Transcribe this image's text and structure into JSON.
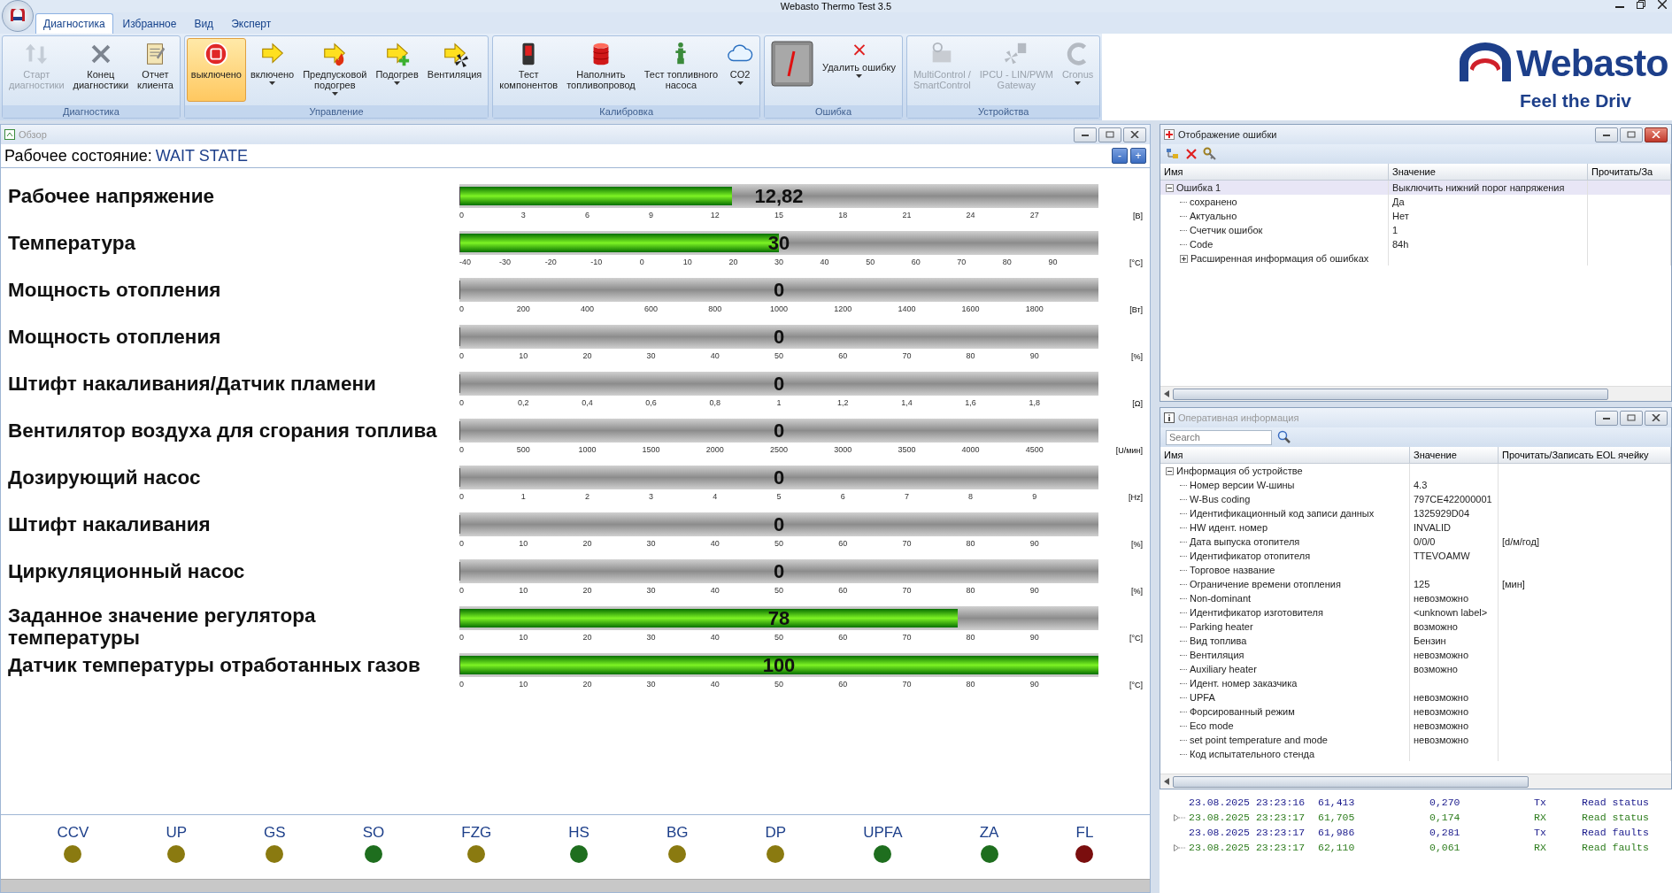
{
  "window": {
    "title": "Webasto Thermo Test 3.5"
  },
  "tabs": [
    {
      "label": "Диагностика",
      "selected": true
    },
    {
      "label": "Избранное",
      "selected": false
    },
    {
      "label": "Вид",
      "selected": false
    },
    {
      "label": "Эксперт",
      "selected": false
    }
  ],
  "ribbon": [
    {
      "group": "Диагностика",
      "buttons": [
        {
          "label": "Старт\nдиагностики",
          "disabled": true,
          "selected": false,
          "dropdown": false
        },
        {
          "label": "Конец\nдиагностики",
          "disabled": false,
          "selected": false,
          "dropdown": false
        },
        {
          "label": "Отчет\nклиента",
          "disabled": false,
          "selected": false,
          "dropdown": false
        }
      ]
    },
    {
      "group": "Управление",
      "buttons": [
        {
          "label": "выключено",
          "disabled": false,
          "selected": true,
          "dropdown": false
        },
        {
          "label": "включено",
          "disabled": false,
          "selected": false,
          "dropdown": true
        },
        {
          "label": "Предпусковой\nподогрев",
          "disabled": false,
          "selected": false,
          "dropdown": true
        },
        {
          "label": "Подогрев",
          "disabled": false,
          "selected": false,
          "dropdown": true
        },
        {
          "label": "Вентиляция",
          "disabled": false,
          "selected": false,
          "dropdown": false
        }
      ]
    },
    {
      "group": "Калибровка",
      "buttons": [
        {
          "label": "Тест\nкомпонентов",
          "disabled": false,
          "selected": false,
          "dropdown": false
        },
        {
          "label": "Наполнить\nтопливопровод",
          "disabled": false,
          "selected": false,
          "dropdown": false
        },
        {
          "label": "Тест топливного\nнасоса",
          "disabled": false,
          "selected": false,
          "dropdown": false
        },
        {
          "label": "CO2",
          "disabled": false,
          "selected": false,
          "dropdown": true
        }
      ]
    },
    {
      "group": "Ошибка",
      "buttons": [
        {
          "disabled": false,
          "selected": false,
          "dropdown": false
        },
        {
          "label": "Удалить ошибку",
          "disabled": false,
          "selected": false,
          "dropdown": true
        }
      ]
    },
    {
      "group": "Устройства",
      "buttons": [
        {
          "label": "MultiControl /\nSmartControl",
          "disabled": true,
          "selected": false,
          "dropdown": false
        },
        {
          "label": "IPCU - LIN/PWM\nGateway",
          "disabled": true,
          "selected": false,
          "dropdown": false
        },
        {
          "label": "Cronus",
          "disabled": true,
          "selected": false,
          "dropdown": true
        }
      ]
    }
  ],
  "logo": {
    "name": "Webasto",
    "tagline": "Feel the Driv"
  },
  "overview": {
    "title": "Обзор",
    "active": false,
    "state_label": "Рабочее состояние:",
    "state_value": "WAIT STATE",
    "buttons": [
      "-",
      "+"
    ],
    "gauges": [
      {
        "label": "Рабочее напряжение",
        "value": "12,82",
        "level": 0.427,
        "unit": "[B]",
        "ticks": [
          "0",
          "3",
          "6",
          "9",
          "12",
          "15",
          "18",
          "21",
          "24",
          "27"
        ]
      },
      {
        "label": "Температура",
        "value": "30",
        "level": 0.5,
        "unit": "[°C]",
        "ticks": [
          "-40",
          "-30",
          "-20",
          "-10",
          "0",
          "10",
          "20",
          "30",
          "40",
          "50",
          "60",
          "70",
          "80",
          "90"
        ]
      },
      {
        "label": "Мощность отопления",
        "value": "0",
        "level": 0,
        "unit": "[Вт]",
        "ticks": [
          "0",
          "200",
          "400",
          "600",
          "800",
          "1000",
          "1200",
          "1400",
          "1600",
          "1800"
        ]
      },
      {
        "label": "Мощность отопления",
        "value": "0",
        "level": 0,
        "unit": "[%]",
        "ticks": [
          "0",
          "10",
          "20",
          "30",
          "40",
          "50",
          "60",
          "70",
          "80",
          "90"
        ]
      },
      {
        "label": "Штифт накаливания/Датчик пламени",
        "value": "0",
        "level": 0,
        "unit": "[Ω]",
        "ticks": [
          "0",
          "0,2",
          "0,4",
          "0,6",
          "0,8",
          "1",
          "1,2",
          "1,4",
          "1,6",
          "1,8"
        ]
      },
      {
        "label": "Вентилятор воздуха для сгорания топлива",
        "value": "0",
        "level": 0,
        "unit": "[U/мин]",
        "ticks": [
          "0",
          "500",
          "1000",
          "1500",
          "2000",
          "2500",
          "3000",
          "3500",
          "4000",
          "4500"
        ]
      },
      {
        "label": "Дозирующий насос",
        "value": "0",
        "level": 0,
        "unit": "[Hz]",
        "ticks": [
          "0",
          "1",
          "2",
          "3",
          "4",
          "5",
          "6",
          "7",
          "8",
          "9"
        ]
      },
      {
        "label": "Штифт накаливания",
        "value": "0",
        "level": 0,
        "unit": "[%]",
        "ticks": [
          "0",
          "10",
          "20",
          "30",
          "40",
          "50",
          "60",
          "70",
          "80",
          "90"
        ]
      },
      {
        "label": "Циркуляционный насос",
        "value": "0",
        "level": 0,
        "unit": "[%]",
        "ticks": [
          "0",
          "10",
          "20",
          "30",
          "40",
          "50",
          "60",
          "70",
          "80",
          "90"
        ]
      },
      {
        "label": "Заданное значение регулятора температуры",
        "value": "78",
        "level": 0.78,
        "unit": "[°C]",
        "ticks": [
          "0",
          "10",
          "20",
          "30",
          "40",
          "50",
          "60",
          "70",
          "80",
          "90"
        ]
      },
      {
        "label": "Датчик температуры отработанных газов",
        "value": "100",
        "level": 1,
        "unit": "[°C]",
        "ticks": [
          "0",
          "10",
          "20",
          "30",
          "40",
          "50",
          "60",
          "70",
          "80",
          "90"
        ]
      }
    ],
    "indicators": [
      {
        "label": "CCV",
        "color": "#8a7a10"
      },
      {
        "label": "UP",
        "color": "#8a7a10"
      },
      {
        "label": "GS",
        "color": "#8a7a10"
      },
      {
        "label": "SO",
        "color": "#1e6e1e"
      },
      {
        "label": "FZG",
        "color": "#8a7a10"
      },
      {
        "label": "HS",
        "color": "#1e6e1e"
      },
      {
        "label": "BG",
        "color": "#8a7a10"
      },
      {
        "label": "DP",
        "color": "#8a7a10"
      },
      {
        "label": "UPFA",
        "color": "#1e6e1e"
      },
      {
        "label": "ZA",
        "color": "#1e6e1e"
      },
      {
        "label": "FL",
        "color": "#7a0e0e"
      }
    ]
  },
  "error_panel": {
    "title": "Отображение ошибки",
    "active": true,
    "columns": [
      "Имя",
      "Значение",
      "Прочитать/За"
    ],
    "rows": [
      {
        "name": "Ошибка 1",
        "value": "Выключить нижний порог напряжения",
        "selected": true,
        "expanded": true,
        "children": [
          {
            "name": "сохранено",
            "value": "Да",
            "selected": false
          },
          {
            "name": "Актуально",
            "value": "Нет",
            "selected": false
          },
          {
            "name": "Счетчик ошибок",
            "value": "1",
            "selected": false
          },
          {
            "name": "Code",
            "value": "84h",
            "selected": false
          },
          {
            "name": "Расширенная информация об ошибках",
            "selected": false,
            "expanded": false
          }
        ]
      }
    ]
  },
  "info_panel": {
    "title": "Оперативная информация",
    "active": false,
    "search": {
      "placeholder": "Search"
    },
    "columns": [
      "Имя",
      "Значение",
      "Прочитать/Записать EOL ячейку"
    ],
    "rows": [
      {
        "name": "Информация об устройстве",
        "expanded": true,
        "children": [
          {
            "name": "Номер версии W-шины",
            "value": "4.3"
          },
          {
            "name": "W-Bus coding",
            "value": "797CE422000001"
          },
          {
            "name": "Идентификационный код записи данных",
            "value": "1325929D04"
          },
          {
            "name": "HW идент. номер",
            "value": "INVALID"
          },
          {
            "name": "Дата выпуска отопителя",
            "value": "0/0/0",
            "eol": "[d/м/год]"
          },
          {
            "name": "Идентификатор отопителя",
            "value": "TTEVOAMW"
          },
          {
            "name": "Торговое название"
          },
          {
            "name": "Ограничение времени отопления",
            "value": "125",
            "eol": "[мин]"
          },
          {
            "name": "Non-dominant",
            "value": "невозможно"
          },
          {
            "name": "Идентификатор изготовителя",
            "value": "<unknown label>"
          },
          {
            "name": "Parking heater",
            "value": "возможно"
          },
          {
            "name": "Вид топлива",
            "value": "Бензин"
          },
          {
            "name": "Вентиляция",
            "value": "невозможно"
          },
          {
            "name": "Auxiliary heater",
            "value": "возможно"
          },
          {
            "name": "Идент. номер заказчика"
          },
          {
            "name": "UPFA",
            "value": "невозможно"
          },
          {
            "name": "Форсированный режим",
            "value": "невозможно"
          },
          {
            "name": "Eco mode",
            "value": "невозможно"
          },
          {
            "name": "set point temperature and mode",
            "value": "невозможно"
          },
          {
            "name": "Код испытательного стенда"
          }
        ]
      }
    ]
  },
  "log": {
    "rows": [
      {
        "date_time": "23.08.2025 23:23:16",
        "column_2": "61,413",
        "column_3": "0,270",
        "direction": "Tx",
        "message": "Read status",
        "color": "#1a1a8c",
        "expandable": false
      },
      {
        "date_time": "23.08.2025 23:23:17",
        "column_2": "61,705",
        "column_3": "0,174",
        "direction": "RX",
        "message": "Read status",
        "color": "#2e7d1e",
        "expandable": true
      },
      {
        "date_time": "23.08.2025 23:23:17",
        "column_2": "61,986",
        "column_3": "0,281",
        "direction": "Tx",
        "message": "Read faults",
        "color": "#1a1a8c",
        "expandable": false
      },
      {
        "date_time": "23.08.2025 23:23:17",
        "column_2": "62,110",
        "column_3": "0,061",
        "direction": "RX",
        "message": "Read faults",
        "color": "#2e7d1e",
        "expandable": true
      }
    ]
  }
}
